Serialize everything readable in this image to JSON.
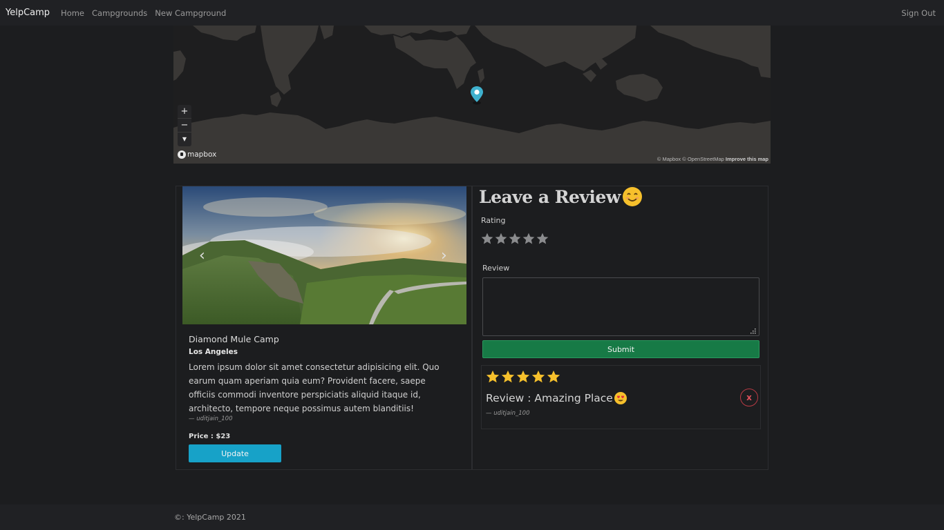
{
  "navbar": {
    "brand": "YelpCamp",
    "links": [
      "Home",
      "Campgrounds",
      "New Campground"
    ],
    "signout": "Sign Out"
  },
  "map": {
    "logo_text": "mapbox",
    "attribution": "© Mapbox © OpenStreetMap",
    "improve": "Improve this map",
    "zoom_in": "+",
    "zoom_out": "−",
    "compass": "▼",
    "land_color": "#3a3836",
    "marker_color": "#3fb1ce"
  },
  "campground": {
    "title": "Diamond Mule Camp",
    "location": "Los Angeles",
    "description": "Lorem ipsum dolor sit amet consectetur adipisicing elit. Quo earum quam aperiam quia eum? Provident facere, saepe officiis commodi inventore perspiciatis aliquid itaque id, architecto, tempore neque possimus autem blanditiis!",
    "author": "— uditjain_100",
    "price": "Price : $23",
    "update_label": "Update",
    "carousel_prev": "‹",
    "carousel_next": "›"
  },
  "review_form": {
    "heading": "Leave a Review",
    "rating_label": "Rating",
    "review_label": "Review",
    "submit_label": "Submit",
    "star_count": 5
  },
  "reviews": [
    {
      "rating": 5,
      "text": "Review : Amazing Place",
      "author": "— uditjain_100",
      "delete_label": "x"
    }
  ],
  "footer": {
    "text": "©: YelpCamp 2021"
  },
  "colors": {
    "background": "#1c1d1f",
    "navbar": "#202124",
    "update_button": "#17a2c8",
    "submit_button": "#177a46",
    "star_filled": "#f6c02c",
    "star_empty": "#8a8b8d",
    "delete_border": "#b83a44"
  }
}
